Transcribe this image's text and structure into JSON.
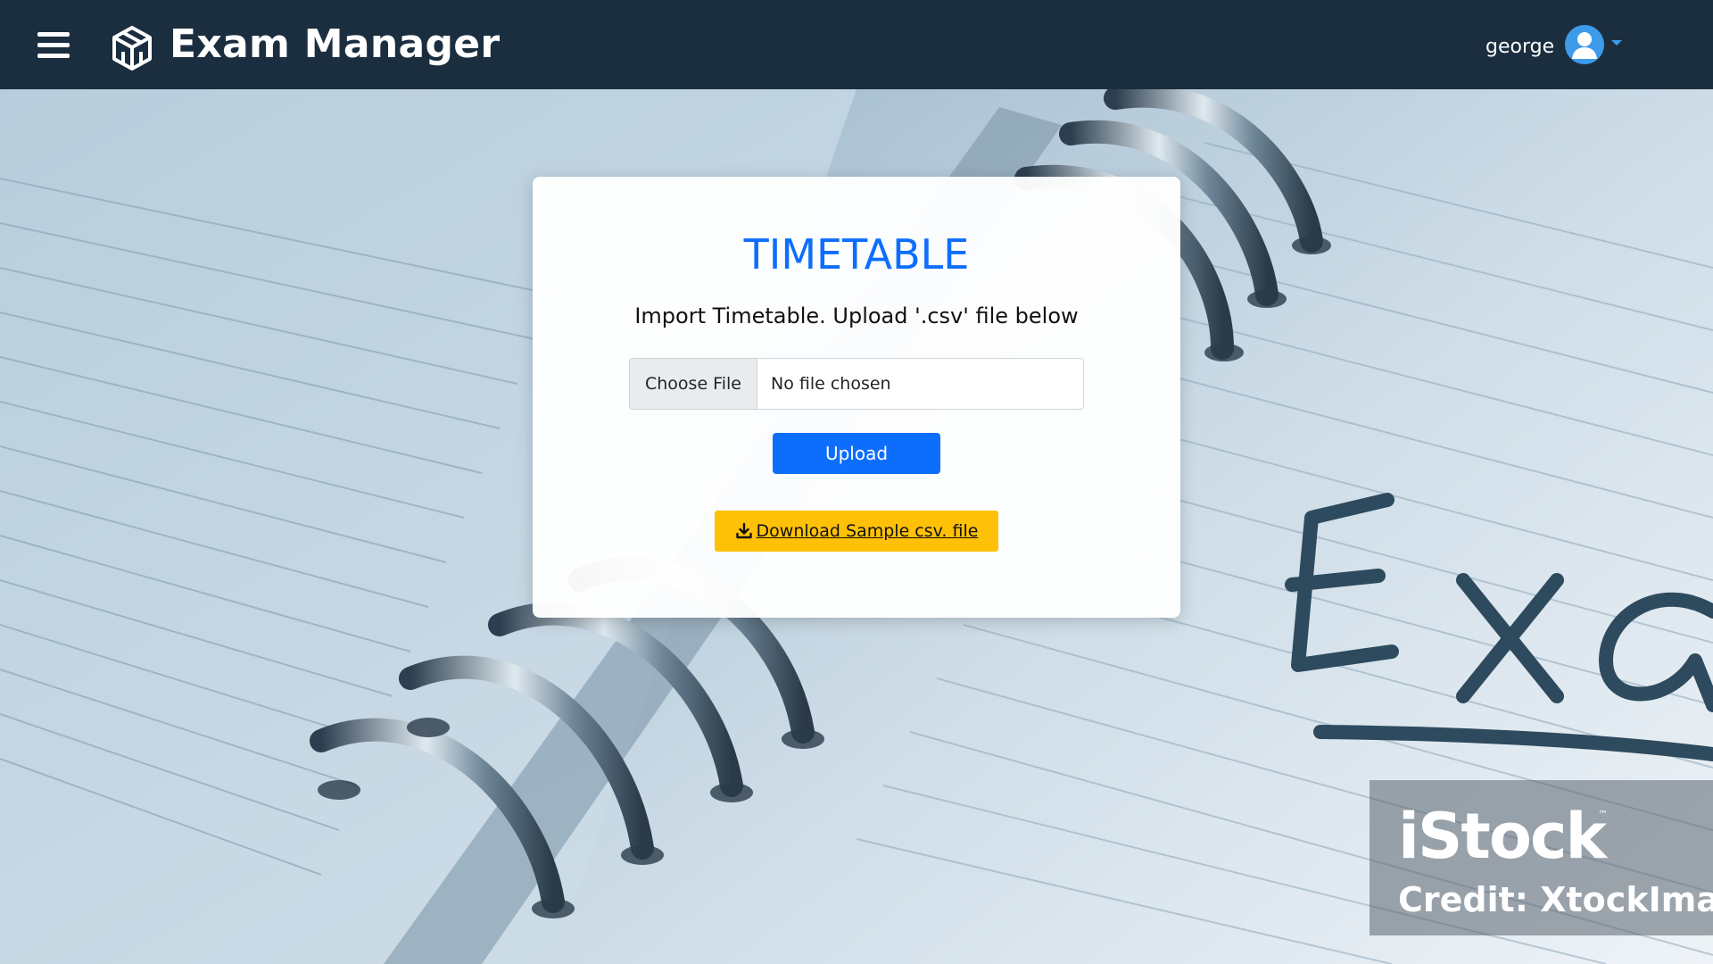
{
  "navbar": {
    "brand_name": "Exam Manager",
    "user_name": "george",
    "menu_icon": "hamburger-menu-icon",
    "logo_icon": "cube-logo-icon",
    "avatar_icon": "user-avatar-icon",
    "caret_icon": "caret-down-icon",
    "background_color": "#1b2e3f"
  },
  "card": {
    "title": "TIMETABLE",
    "subtitle": "Import Timetable. Upload '.csv' file below",
    "file_input": {
      "button_label": "Choose File",
      "status_text": "No file chosen"
    },
    "upload_label": "Upload",
    "download_label": "Download Sample csv. file",
    "download_icon": "download-icon",
    "title_color": "#0d6efd",
    "upload_color": "#0d6efd",
    "download_color": "#ffc107"
  },
  "background": {
    "handwriting": "Exa",
    "watermark_logo": "iStock",
    "watermark_tm": "™",
    "watermark_credit": "Credit: XtockIma"
  }
}
